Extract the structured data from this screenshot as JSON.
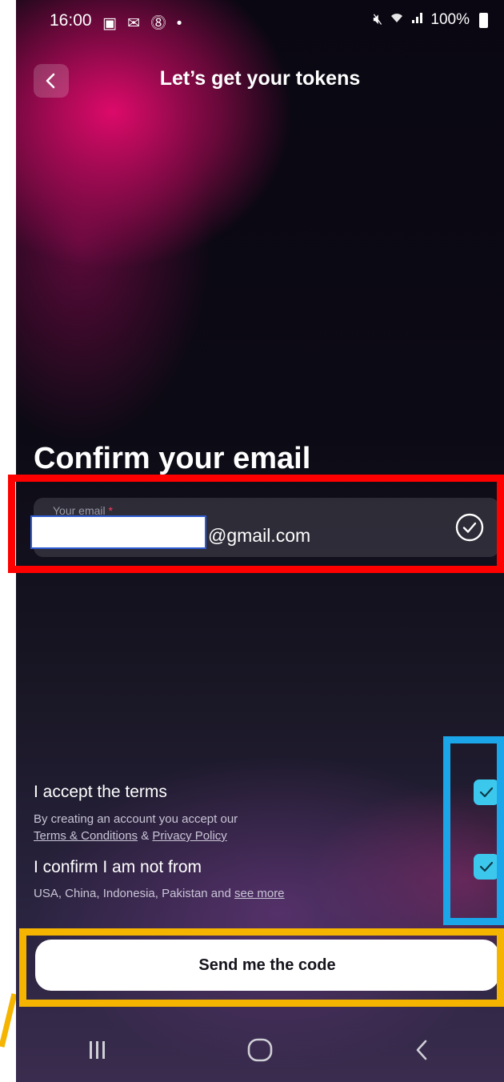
{
  "status_bar": {
    "time": "16:00",
    "left_icons": [
      "picture-icon",
      "mail-icon",
      "s-badge-icon",
      "dot-icon"
    ],
    "right_text": "100%",
    "right_icons": [
      "mute-icon",
      "wifi-icon",
      "signal-icon",
      "battery-icon"
    ]
  },
  "header": {
    "title": "Let’s get your tokens",
    "back_icon": "chevron-left-icon"
  },
  "page": {
    "title": "Confirm your email"
  },
  "email_field": {
    "label": "Your email",
    "required_mark": "*",
    "value_suffix": "@gmail.com",
    "status_icon": "check-circle-icon"
  },
  "consents": [
    {
      "title": "I accept the terms",
      "subtitle_prefix": "By creating an account you accept our",
      "link1": "Terms & Conditions",
      "joiner": "&",
      "link2": "Privacy Policy",
      "checked": true
    },
    {
      "title": "I confirm I am not from",
      "subtitle_prefix": "USA, China, Indonesia, Pakistan and",
      "link1": "see more",
      "checked": true
    }
  ],
  "send_button": {
    "label": "Send me the code"
  },
  "nav_bar": {
    "items": [
      "recent-apps-icon",
      "home-icon",
      "back-icon"
    ]
  },
  "colors": {
    "annotation_red": "#ff0000",
    "annotation_blue": "#1aa6e8",
    "annotation_yellow": "#f4b400",
    "checkbox_accent": "#3cc8ec",
    "primary_button": "#ffffff"
  }
}
